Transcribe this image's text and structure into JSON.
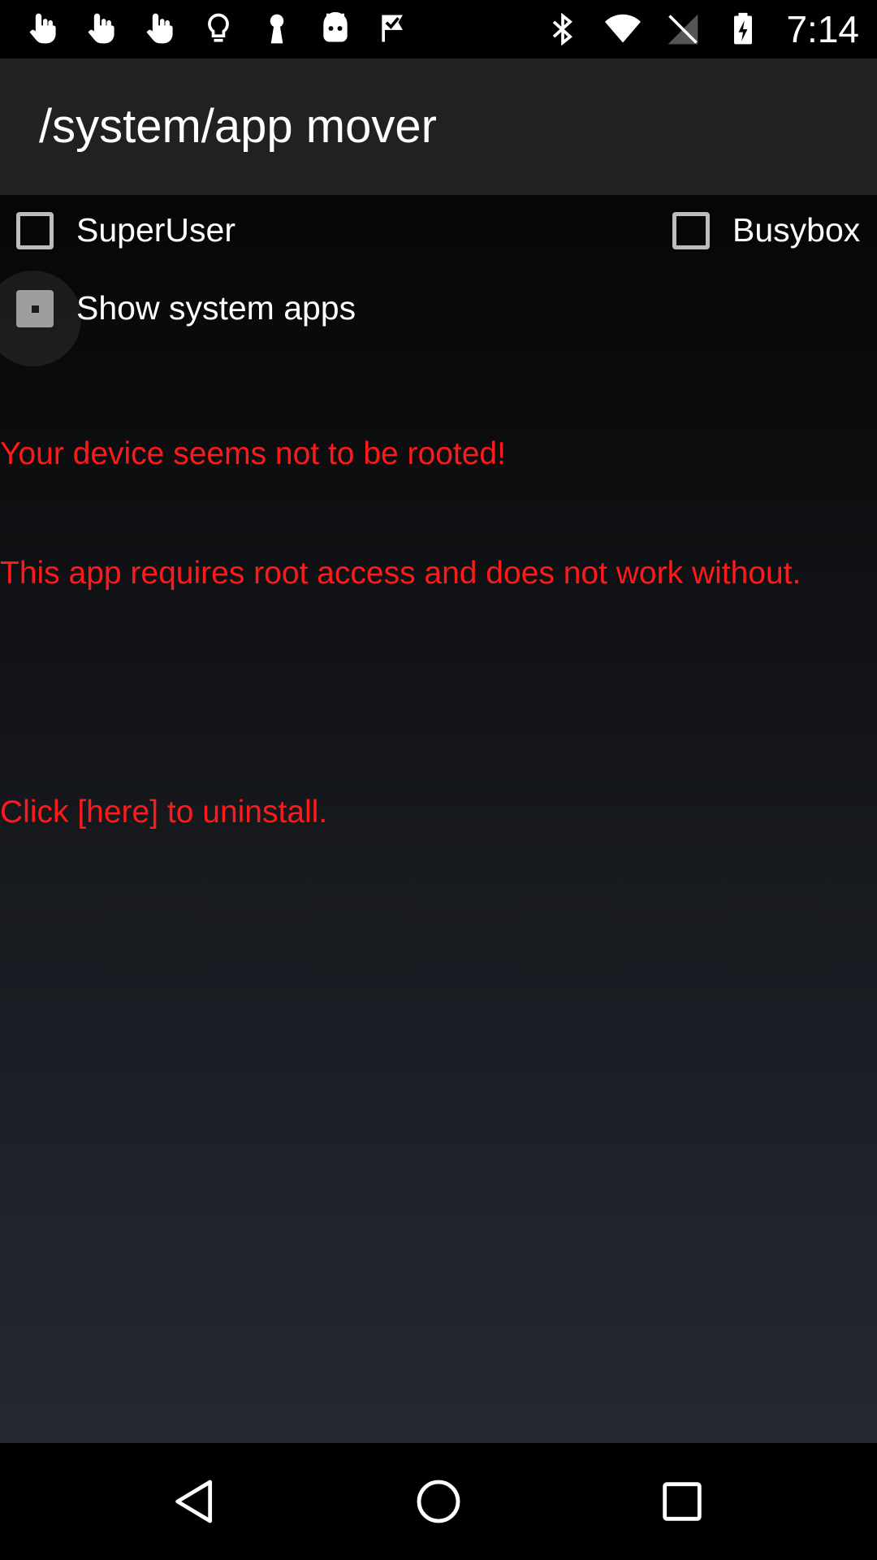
{
  "status_bar": {
    "left_icons": [
      "hand-touch-icon",
      "hand-touch-icon",
      "hand-touch-icon",
      "lightbulb-icon",
      "keyhole-icon",
      "android-face-icon",
      "check-flag-icon"
    ],
    "right_icons": [
      "bluetooth-icon",
      "wifi-icon",
      "no-signal-icon",
      "battery-charging-icon"
    ],
    "time": "7:14"
  },
  "app_bar": {
    "title": "/system/app mover"
  },
  "options": {
    "superuser_label": "SuperUser",
    "busybox_label": "Busybox",
    "show_system_apps_label": "Show system apps"
  },
  "warning": {
    "line1": "Your device seems not to be rooted!",
    "line2": "This app requires root access and does not work without.",
    "line3": "Click [here] to uninstall."
  },
  "nav_bar": {
    "icons": [
      "back-icon",
      "home-icon",
      "recents-icon"
    ]
  },
  "colors": {
    "warning_text": "#ff1a1a",
    "app_bar_bg": "#212121"
  }
}
